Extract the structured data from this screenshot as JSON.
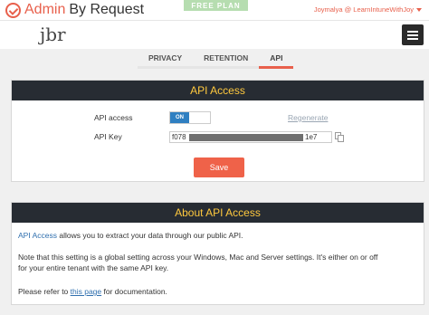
{
  "brand": {
    "name_accent": "Admin",
    "name_rest": "By Request",
    "plan_badge": "FREE PLAN"
  },
  "user": {
    "label": "Joymalya @ LearnIntuneWithJoy"
  },
  "logo": {
    "text": "jbr"
  },
  "tabs": [
    {
      "label": "PRIVACY",
      "active": false
    },
    {
      "label": "RETENTION",
      "active": false
    },
    {
      "label": "API",
      "active": true
    }
  ],
  "api_access": {
    "title": "API Access",
    "access_label": "API access",
    "toggle_state": "ON",
    "regenerate_label": "Regenerate",
    "key_label": "API Key",
    "key_prefix": "f078",
    "key_suffix": "1e7",
    "save_label": "Save"
  },
  "about": {
    "title": "About API Access",
    "p1_link": "API Access",
    "p1_text": " allows you to extract your data through our public API.",
    "p2_line1": "Note that this setting is a global setting across your Windows, Mac and Server settings. It's either on or off",
    "p2_line2": "for your entire tenant with the same API key.",
    "p3_before": "Please refer to ",
    "p3_link": "this page",
    "p3_after": " for documentation."
  },
  "colors": {
    "accent": "#e8604c",
    "header_bg": "#272c33",
    "header_text": "#ffc93e",
    "toggle_on": "#2f7fc1",
    "save": "#ef6249"
  }
}
